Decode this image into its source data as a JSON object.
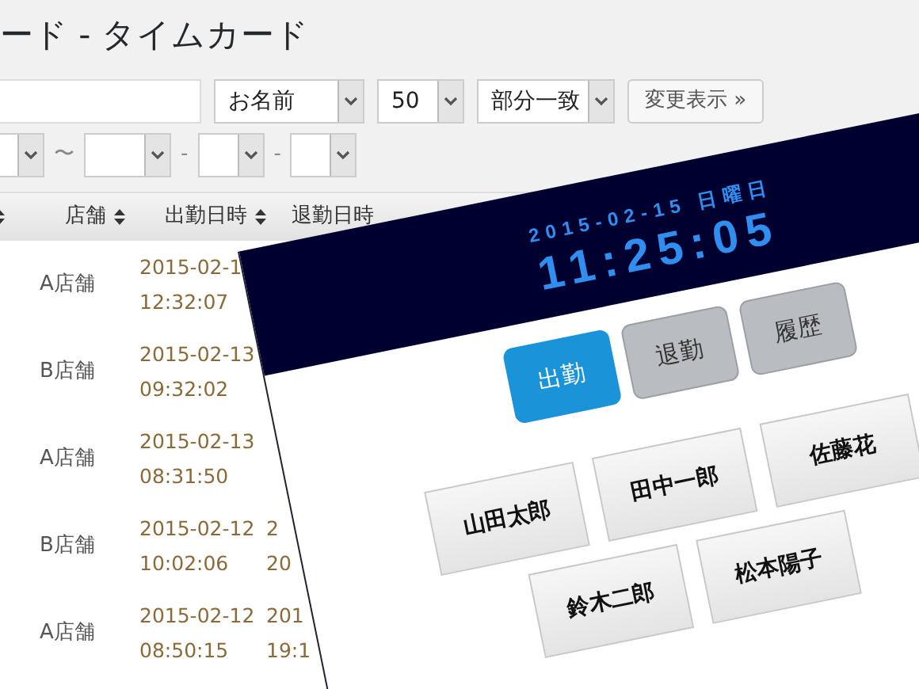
{
  "page": {
    "title": "ード - タイムカード"
  },
  "filters": {
    "field_select": "お名前",
    "count_select": "50",
    "match_select": "部分一致",
    "submit": "変更表示 »",
    "date_separators": [
      "〜",
      "-",
      "-"
    ]
  },
  "table": {
    "columns": [
      {
        "sortable": true
      },
      {
        "label": "店舗",
        "sortable": true
      },
      {
        "label": "出勤日時",
        "sortable": true
      },
      {
        "label": "退勤日時",
        "sortable": false
      }
    ],
    "rows": [
      {
        "store": "A店舗",
        "checkin": [
          "2015-02-1",
          "12:32:07"
        ]
      },
      {
        "store": "B店舗",
        "checkin": [
          "2015-02-13",
          "09:32:02"
        ]
      },
      {
        "store": "A店舗",
        "checkin": [
          "2015-02-13",
          "08:31:50"
        ]
      },
      {
        "store": "B店舗",
        "checkin": [
          "2015-02-12",
          "10:02:06"
        ],
        "checkout": [
          "2",
          "20"
        ]
      },
      {
        "store": "A店舗",
        "checkin": [
          "2015-02-12",
          "08:50:15"
        ],
        "checkout": [
          "201",
          "19:1"
        ]
      }
    ]
  },
  "clock": {
    "date": "2015-02-15 日曜日",
    "time": "11:25:05",
    "modes": [
      {
        "label": "出勤",
        "selected": true
      },
      {
        "label": "退勤",
        "selected": false
      },
      {
        "label": "履歴",
        "selected": false
      }
    ],
    "staff": [
      "山田太郎",
      "田中一郎",
      "佐藤花",
      "鈴木二郎",
      "松本陽子"
    ]
  }
}
